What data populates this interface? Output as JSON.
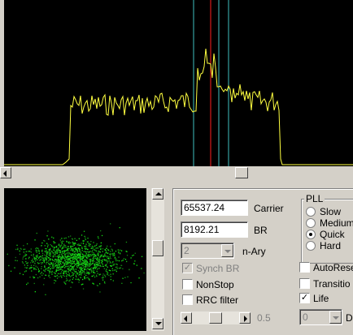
{
  "spectrum": {
    "background": "#000000",
    "trace_color": "#ffff40",
    "marker_cyan": "#40c0c0",
    "marker_red": "#ff2020"
  },
  "constellation": {
    "background": "#000000",
    "dot_color": "#30d030"
  },
  "panel": {
    "carrier_value": "65537.24",
    "carrier_label": "Carrier",
    "br_value": "8192.21",
    "br_label": "BR",
    "nary_value": "2",
    "nary_label": "n-Ary",
    "synch_br_label": "Synch BR",
    "nonstop_label": "NonStop",
    "rrc_filter_label": "RRC filter",
    "slider_value": "0.5",
    "pll": {
      "title": "PLL",
      "options": [
        "Slow",
        "Medium",
        "Quick",
        "Hard"
      ],
      "selected": "Quick"
    },
    "autoreset_label": "AutoRese",
    "transition_label": "Transitio",
    "life_label": "Life",
    "bottom_select_value": "0",
    "bottom_select_label": "Di"
  }
}
